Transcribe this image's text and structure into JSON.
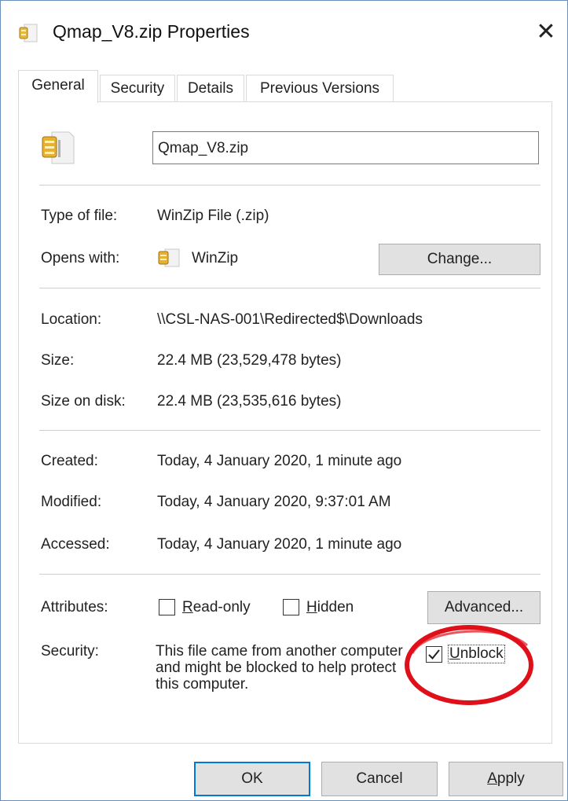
{
  "window": {
    "title": "Qmap_V8.zip Properties",
    "close_glyph": "✕"
  },
  "tabs": [
    {
      "label": "General",
      "active": true
    },
    {
      "label": "Security",
      "active": false
    },
    {
      "label": "Details",
      "active": false
    },
    {
      "label": "Previous Versions",
      "active": false
    }
  ],
  "general": {
    "file_name": "Qmap_V8.zip",
    "type_label": "Type of file:",
    "type_value": "WinZip File (.zip)",
    "opens_label": "Opens with:",
    "opens_value": "WinZip",
    "change_button": "Change...",
    "location_label": "Location:",
    "location_value": "\\\\CSL-NAS-001\\Redirected$\\Downloads",
    "size_label": "Size:",
    "size_value": "22.4 MB (23,529,478 bytes)",
    "size_disk_label": "Size on disk:",
    "size_disk_value": "22.4 MB (23,535,616 bytes)",
    "created_label": "Created:",
    "created_value": "Today, 4 January 2020, 1 minute ago",
    "modified_label": "Modified:",
    "modified_value": "Today, 4 January 2020, 9:37:01 AM",
    "accessed_label": "Accessed:",
    "accessed_value": "Today, 4 January 2020, 1 minute ago",
    "attributes_label": "Attributes:",
    "readonly_label": "Read-only",
    "readonly_checked": false,
    "hidden_label": "Hidden",
    "hidden_checked": false,
    "advanced_button": "Advanced...",
    "security_label": "Security:",
    "security_text": "This file came from another computer and might be blocked to help protect this computer.",
    "unblock_label": "Unblock",
    "unblock_checked": true
  },
  "footer": {
    "ok": "OK",
    "cancel": "Cancel",
    "apply": "Apply"
  },
  "colors": {
    "annotation_circle": "#e0101a",
    "focus_border": "#0078d7",
    "window_border": "#6a8fb8"
  },
  "icons": {
    "title": "winzip-archive-icon",
    "file": "winzip-archive-icon",
    "app": "winzip-app-icon"
  }
}
